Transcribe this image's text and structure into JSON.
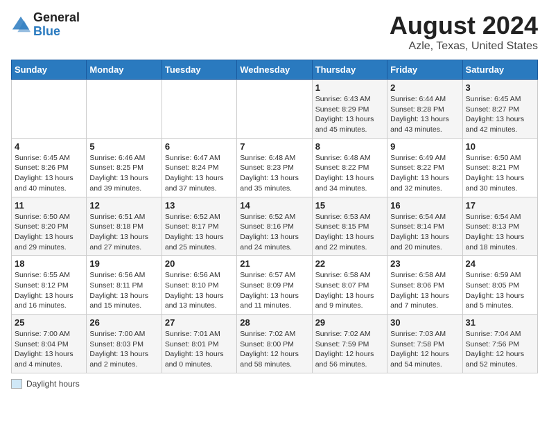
{
  "header": {
    "logo_general": "General",
    "logo_blue": "Blue",
    "title": "August 2024",
    "subtitle": "Azle, Texas, United States"
  },
  "calendar": {
    "weekdays": [
      "Sunday",
      "Monday",
      "Tuesday",
      "Wednesday",
      "Thursday",
      "Friday",
      "Saturday"
    ],
    "weeks": [
      [
        {
          "day": "",
          "info": ""
        },
        {
          "day": "",
          "info": ""
        },
        {
          "day": "",
          "info": ""
        },
        {
          "day": "",
          "info": ""
        },
        {
          "day": "1",
          "info": "Sunrise: 6:43 AM\nSunset: 8:29 PM\nDaylight: 13 hours and 45 minutes."
        },
        {
          "day": "2",
          "info": "Sunrise: 6:44 AM\nSunset: 8:28 PM\nDaylight: 13 hours and 43 minutes."
        },
        {
          "day": "3",
          "info": "Sunrise: 6:45 AM\nSunset: 8:27 PM\nDaylight: 13 hours and 42 minutes."
        }
      ],
      [
        {
          "day": "4",
          "info": "Sunrise: 6:45 AM\nSunset: 8:26 PM\nDaylight: 13 hours and 40 minutes."
        },
        {
          "day": "5",
          "info": "Sunrise: 6:46 AM\nSunset: 8:25 PM\nDaylight: 13 hours and 39 minutes."
        },
        {
          "day": "6",
          "info": "Sunrise: 6:47 AM\nSunset: 8:24 PM\nDaylight: 13 hours and 37 minutes."
        },
        {
          "day": "7",
          "info": "Sunrise: 6:48 AM\nSunset: 8:23 PM\nDaylight: 13 hours and 35 minutes."
        },
        {
          "day": "8",
          "info": "Sunrise: 6:48 AM\nSunset: 8:22 PM\nDaylight: 13 hours and 34 minutes."
        },
        {
          "day": "9",
          "info": "Sunrise: 6:49 AM\nSunset: 8:22 PM\nDaylight: 13 hours and 32 minutes."
        },
        {
          "day": "10",
          "info": "Sunrise: 6:50 AM\nSunset: 8:21 PM\nDaylight: 13 hours and 30 minutes."
        }
      ],
      [
        {
          "day": "11",
          "info": "Sunrise: 6:50 AM\nSunset: 8:20 PM\nDaylight: 13 hours and 29 minutes."
        },
        {
          "day": "12",
          "info": "Sunrise: 6:51 AM\nSunset: 8:18 PM\nDaylight: 13 hours and 27 minutes."
        },
        {
          "day": "13",
          "info": "Sunrise: 6:52 AM\nSunset: 8:17 PM\nDaylight: 13 hours and 25 minutes."
        },
        {
          "day": "14",
          "info": "Sunrise: 6:52 AM\nSunset: 8:16 PM\nDaylight: 13 hours and 24 minutes."
        },
        {
          "day": "15",
          "info": "Sunrise: 6:53 AM\nSunset: 8:15 PM\nDaylight: 13 hours and 22 minutes."
        },
        {
          "day": "16",
          "info": "Sunrise: 6:54 AM\nSunset: 8:14 PM\nDaylight: 13 hours and 20 minutes."
        },
        {
          "day": "17",
          "info": "Sunrise: 6:54 AM\nSunset: 8:13 PM\nDaylight: 13 hours and 18 minutes."
        }
      ],
      [
        {
          "day": "18",
          "info": "Sunrise: 6:55 AM\nSunset: 8:12 PM\nDaylight: 13 hours and 16 minutes."
        },
        {
          "day": "19",
          "info": "Sunrise: 6:56 AM\nSunset: 8:11 PM\nDaylight: 13 hours and 15 minutes."
        },
        {
          "day": "20",
          "info": "Sunrise: 6:56 AM\nSunset: 8:10 PM\nDaylight: 13 hours and 13 minutes."
        },
        {
          "day": "21",
          "info": "Sunrise: 6:57 AM\nSunset: 8:09 PM\nDaylight: 13 hours and 11 minutes."
        },
        {
          "day": "22",
          "info": "Sunrise: 6:58 AM\nSunset: 8:07 PM\nDaylight: 13 hours and 9 minutes."
        },
        {
          "day": "23",
          "info": "Sunrise: 6:58 AM\nSunset: 8:06 PM\nDaylight: 13 hours and 7 minutes."
        },
        {
          "day": "24",
          "info": "Sunrise: 6:59 AM\nSunset: 8:05 PM\nDaylight: 13 hours and 5 minutes."
        }
      ],
      [
        {
          "day": "25",
          "info": "Sunrise: 7:00 AM\nSunset: 8:04 PM\nDaylight: 13 hours and 4 minutes."
        },
        {
          "day": "26",
          "info": "Sunrise: 7:00 AM\nSunset: 8:03 PM\nDaylight: 13 hours and 2 minutes."
        },
        {
          "day": "27",
          "info": "Sunrise: 7:01 AM\nSunset: 8:01 PM\nDaylight: 13 hours and 0 minutes."
        },
        {
          "day": "28",
          "info": "Sunrise: 7:02 AM\nSunset: 8:00 PM\nDaylight: 12 hours and 58 minutes."
        },
        {
          "day": "29",
          "info": "Sunrise: 7:02 AM\nSunset: 7:59 PM\nDaylight: 12 hours and 56 minutes."
        },
        {
          "day": "30",
          "info": "Sunrise: 7:03 AM\nSunset: 7:58 PM\nDaylight: 12 hours and 54 minutes."
        },
        {
          "day": "31",
          "info": "Sunrise: 7:04 AM\nSunset: 7:56 PM\nDaylight: 12 hours and 52 minutes."
        }
      ]
    ]
  },
  "legend": {
    "label": "Daylight hours"
  }
}
